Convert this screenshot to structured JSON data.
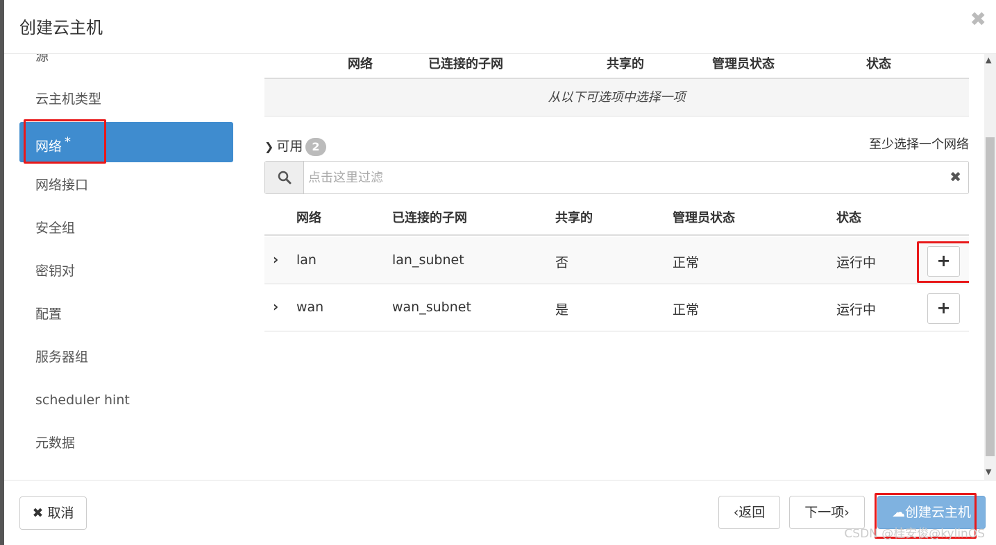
{
  "header": {
    "title": "创建云主机",
    "close": "✖"
  },
  "sidebar": {
    "items": [
      {
        "label": "源"
      },
      {
        "label": "云主机类型"
      },
      {
        "label": "网络",
        "required_mark": "*"
      },
      {
        "label": "网络接口"
      },
      {
        "label": "安全组"
      },
      {
        "label": "密钥对"
      },
      {
        "label": "配置"
      },
      {
        "label": "服务器组"
      },
      {
        "label": "scheduler hint"
      },
      {
        "label": "元数据"
      }
    ]
  },
  "allocated": {
    "columns": [
      "网络",
      "已连接的子网",
      "共享的",
      "管理员状态",
      "状态"
    ],
    "empty_text": "从以下可选项中选择一项"
  },
  "available": {
    "label": "可用",
    "count": "2",
    "hint": "至少选择一个网络",
    "filter_placeholder": "点击这里过滤",
    "columns": [
      "网络",
      "已连接的子网",
      "共享的",
      "管理员状态",
      "状态"
    ],
    "rows": [
      {
        "network": "lan",
        "subnet": "lan_subnet",
        "shared": "否",
        "admin_state": "正常",
        "status": "运行中"
      },
      {
        "network": "wan",
        "subnet": "wan_subnet",
        "shared": "是",
        "admin_state": "正常",
        "status": "运行中"
      }
    ]
  },
  "footer": {
    "cancel": "取消",
    "back": "返回",
    "next": "下一项",
    "launch": "创建云主机",
    "watermark": "CSDN @桂安俊@kylinOS"
  },
  "colors": {
    "accent": "#3f8ccf",
    "highlight": "#e8191a",
    "primary_button": "#7fb2e0"
  }
}
